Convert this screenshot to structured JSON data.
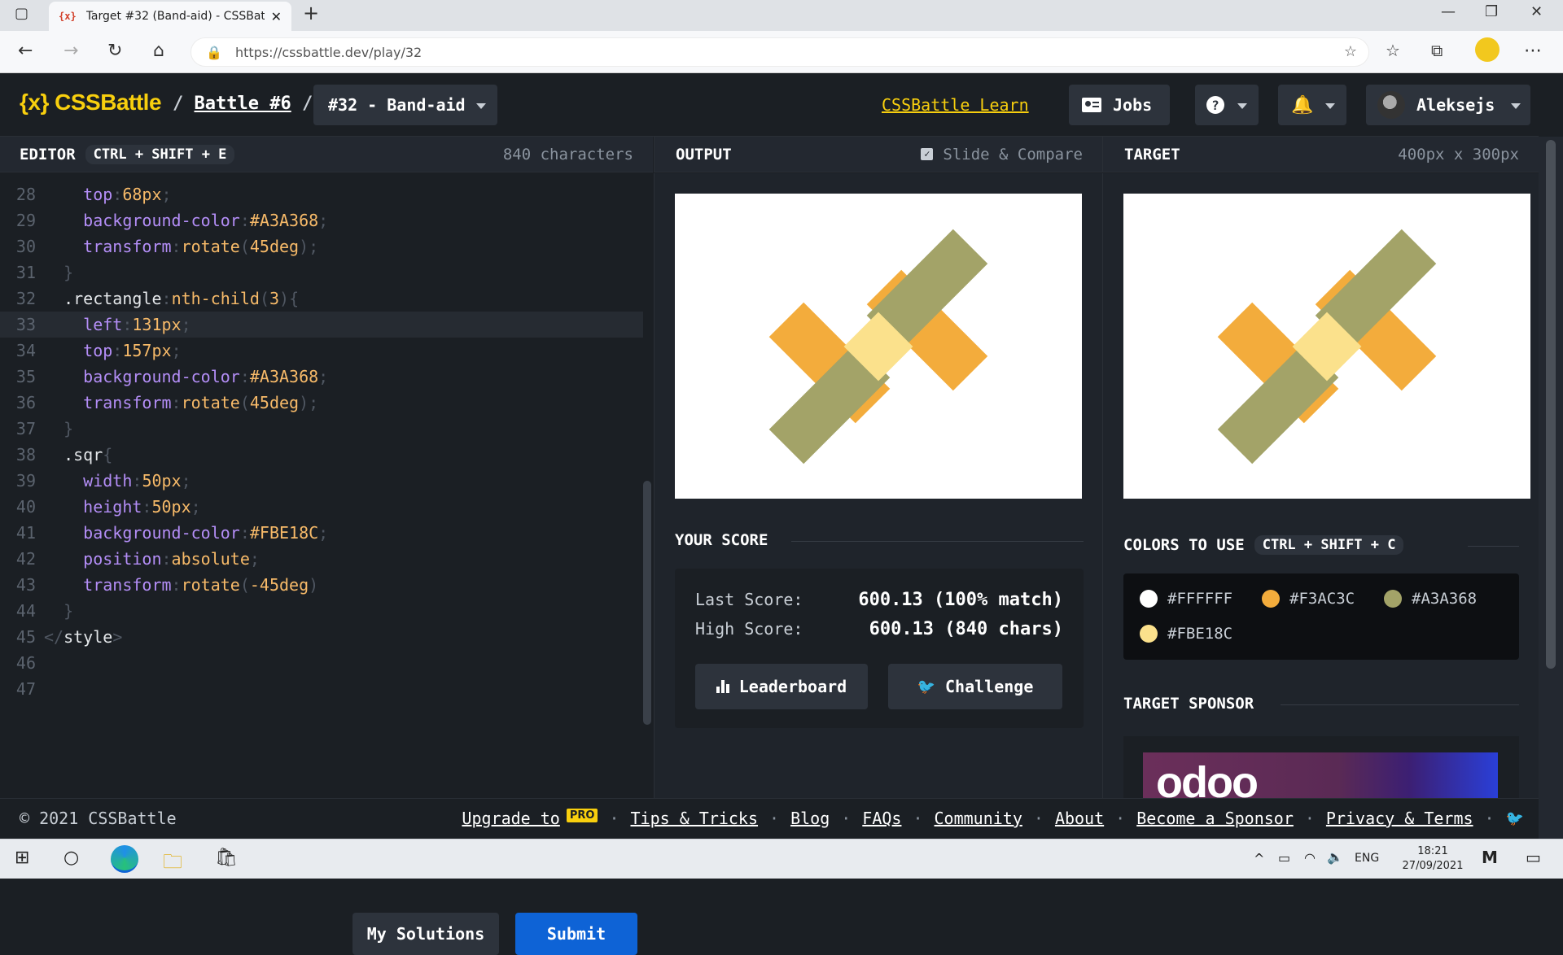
{
  "browser": {
    "tab_title": "Target #32 (Band-aid) - CSSBattle",
    "tab_favicon": "{x}",
    "new_tab": "+",
    "url": "https://cssbattle.dev/play/32"
  },
  "header": {
    "logo": "{x} CSSBattle",
    "battle_link": "Battle #6",
    "target_select": "#32 - Band-aid",
    "learn_link": "CSSBattle Learn",
    "jobs_label": "Jobs",
    "help_label": "?",
    "user_name": "Aleksejs"
  },
  "editor": {
    "title": "EDITOR",
    "shortcut": "CTRL + SHIFT + E",
    "char_count": "840 characters",
    "lines": [
      {
        "n": "28",
        "parts": [
          [
            "",
            "    "
          ],
          [
            "prop",
            "top"
          ],
          [
            "pn",
            ":"
          ],
          [
            "val",
            "68px"
          ],
          [
            "pn",
            ";"
          ]
        ]
      },
      {
        "n": "29",
        "parts": [
          [
            "",
            "    "
          ],
          [
            "prop",
            "background-color"
          ],
          [
            "pn",
            ":"
          ],
          [
            "val",
            "#A3A368"
          ],
          [
            "pn",
            ";"
          ]
        ]
      },
      {
        "n": "30",
        "parts": [
          [
            "",
            "    "
          ],
          [
            "prop",
            "transform"
          ],
          [
            "pn",
            ":"
          ],
          [
            "val",
            "rotate"
          ],
          [
            "pn",
            "("
          ],
          [
            "val",
            "45deg"
          ],
          [
            "pn",
            ");"
          ]
        ]
      },
      {
        "n": "31",
        "parts": [
          [
            "",
            "  "
          ],
          [
            "pn",
            "}"
          ]
        ]
      },
      {
        "n": "32",
        "parts": [
          [
            "",
            "  "
          ],
          [
            "sel",
            ".rectangle"
          ],
          [
            "pn",
            ":"
          ],
          [
            "val",
            "nth-child"
          ],
          [
            "pn",
            "("
          ],
          [
            "val",
            "3"
          ],
          [
            "pn",
            "){"
          ]
        ]
      },
      {
        "n": "33",
        "parts": [
          [
            "",
            "    "
          ],
          [
            "prop",
            "left"
          ],
          [
            "pn",
            ":"
          ],
          [
            "val",
            "131px"
          ],
          [
            "pn",
            ";"
          ]
        ],
        "highlight": true
      },
      {
        "n": "34",
        "parts": [
          [
            "",
            "    "
          ],
          [
            "prop",
            "top"
          ],
          [
            "pn",
            ":"
          ],
          [
            "val",
            "157px"
          ],
          [
            "pn",
            ";"
          ]
        ]
      },
      {
        "n": "35",
        "parts": [
          [
            "",
            "    "
          ],
          [
            "prop",
            "background-color"
          ],
          [
            "pn",
            ":"
          ],
          [
            "val",
            "#A3A368"
          ],
          [
            "pn",
            ";"
          ]
        ]
      },
      {
        "n": "36",
        "parts": [
          [
            "",
            "    "
          ],
          [
            "prop",
            "transform"
          ],
          [
            "pn",
            ":"
          ],
          [
            "val",
            "rotate"
          ],
          [
            "pn",
            "("
          ],
          [
            "val",
            "45deg"
          ],
          [
            "pn",
            ");"
          ]
        ]
      },
      {
        "n": "37",
        "parts": [
          [
            "",
            "  "
          ],
          [
            "pn",
            "}"
          ]
        ]
      },
      {
        "n": "38",
        "parts": [
          [
            "",
            "  "
          ],
          [
            "sel",
            ".sqr"
          ],
          [
            "pn",
            "{"
          ]
        ]
      },
      {
        "n": "39",
        "parts": [
          [
            "",
            "    "
          ],
          [
            "prop",
            "width"
          ],
          [
            "pn",
            ":"
          ],
          [
            "val",
            "50px"
          ],
          [
            "pn",
            ";"
          ]
        ]
      },
      {
        "n": "40",
        "parts": [
          [
            "",
            "    "
          ],
          [
            "prop",
            "height"
          ],
          [
            "pn",
            ":"
          ],
          [
            "val",
            "50px"
          ],
          [
            "pn",
            ";"
          ]
        ]
      },
      {
        "n": "41",
        "parts": [
          [
            "",
            "    "
          ],
          [
            "prop",
            "background-color"
          ],
          [
            "pn",
            ":"
          ],
          [
            "val",
            "#FBE18C"
          ],
          [
            "pn",
            ";"
          ]
        ]
      },
      {
        "n": "42",
        "parts": [
          [
            "",
            "    "
          ],
          [
            "prop",
            "position"
          ],
          [
            "pn",
            ":"
          ],
          [
            "val",
            "absolute"
          ],
          [
            "pn",
            ";"
          ]
        ]
      },
      {
        "n": "43",
        "parts": [
          [
            "",
            "    "
          ],
          [
            "prop",
            "transform"
          ],
          [
            "pn",
            ":"
          ],
          [
            "val",
            "rotate"
          ],
          [
            "pn",
            "("
          ],
          [
            "val",
            "-45deg"
          ],
          [
            "pn",
            ")"
          ]
        ]
      },
      {
        "n": "44",
        "parts": [
          [
            "",
            "  "
          ],
          [
            "pn",
            "}"
          ]
        ]
      },
      {
        "n": "45",
        "parts": [
          [
            "pn",
            "</"
          ],
          [
            "tag",
            "style"
          ],
          [
            "pn",
            ">"
          ]
        ]
      },
      {
        "n": "46",
        "parts": []
      },
      {
        "n": "47",
        "parts": []
      }
    ],
    "my_solutions": "My Solutions",
    "submit": "Submit"
  },
  "output": {
    "title": "OUTPUT",
    "slide_compare": "Slide & Compare",
    "slide_compare_checked": true
  },
  "score": {
    "title": "YOUR SCORE",
    "last_label": "Last Score:",
    "last_value": "600.13 (100% match)",
    "high_label": "High Score:",
    "high_value": "600.13 (840 chars)",
    "leaderboard": "Leaderboard",
    "challenge": "Challenge"
  },
  "target": {
    "title": "TARGET",
    "size": "400px x 300px"
  },
  "colors": {
    "title": "COLORS TO USE",
    "shortcut": "CTRL + SHIFT + C",
    "swatches": [
      {
        "label": "#FFFFFF",
        "color": "#FFFFFF"
      },
      {
        "label": "#F3AC3C",
        "color": "#F3AC3C"
      },
      {
        "label": "#A3A368",
        "color": "#A3A368"
      },
      {
        "label": "#FBE18C",
        "color": "#FBE18C"
      }
    ]
  },
  "sponsor": {
    "title": "TARGET SPONSOR",
    "logo_text": "odoo"
  },
  "footer": {
    "copyright": "© 2021 CSSBattle",
    "upgrade": "Upgrade to",
    "pro": "PRO",
    "tips": "Tips & Tricks",
    "blog": "Blog",
    "faqs": "FAQs",
    "community": "Community",
    "about": "About",
    "sponsor": "Become a Sponsor",
    "privacy": "Privacy & Terms"
  },
  "taskbar": {
    "lang": "ENG",
    "time": "18:21",
    "date": "27/09/2021"
  },
  "theme": {
    "accent_yellow": "#F8CF0E",
    "submit_blue": "#0E63D6",
    "bg": "#1B1F24"
  }
}
